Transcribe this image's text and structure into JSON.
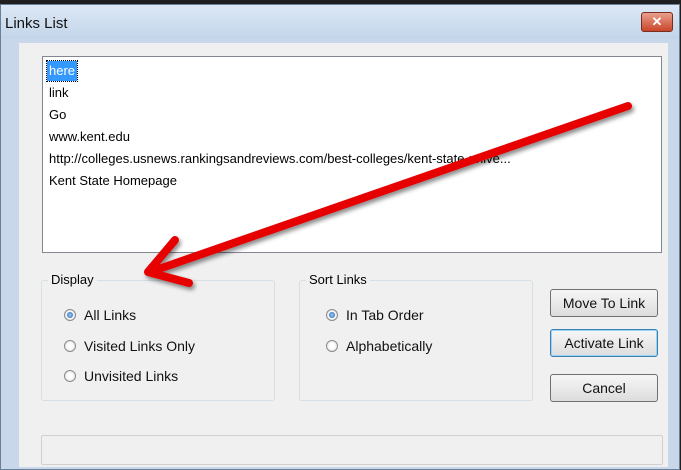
{
  "window": {
    "title": "Links List",
    "close_label": "x"
  },
  "links": [
    "here",
    "link",
    "Go",
    "www.kent.edu",
    "http://colleges.usnews.rankingsandreviews.com/best-colleges/kent-state-unive...",
    "Kent State Homepage"
  ],
  "selected_link": "here",
  "display": {
    "legend": "Display",
    "options": [
      {
        "label": "All Links",
        "checked": true
      },
      {
        "label": "Visited Links Only",
        "checked": false
      },
      {
        "label": "Unvisited Links",
        "checked": false
      }
    ]
  },
  "sort": {
    "legend": "Sort Links",
    "options": [
      {
        "label": "In Tab Order",
        "checked": true
      },
      {
        "label": "Alphabetically",
        "checked": false
      }
    ]
  },
  "buttons": {
    "move_to_link": "Move To Link",
    "activate_link": "Activate Link",
    "cancel": "Cancel"
  },
  "annotation": {
    "arrow_color": "#e60000"
  }
}
